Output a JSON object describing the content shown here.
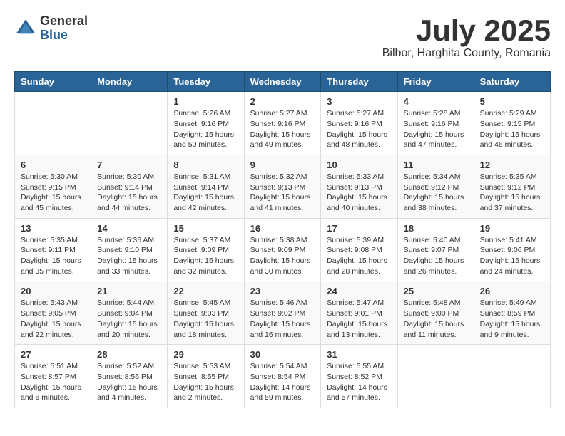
{
  "logo": {
    "general": "General",
    "blue": "Blue"
  },
  "title": "July 2025",
  "subtitle": "Bilbor, Harghita County, Romania",
  "days_of_week": [
    "Sunday",
    "Monday",
    "Tuesday",
    "Wednesday",
    "Thursday",
    "Friday",
    "Saturday"
  ],
  "weeks": [
    [
      {
        "day": "",
        "info": ""
      },
      {
        "day": "",
        "info": ""
      },
      {
        "day": "1",
        "info": "Sunrise: 5:26 AM\nSunset: 9:16 PM\nDaylight: 15 hours and 50 minutes."
      },
      {
        "day": "2",
        "info": "Sunrise: 5:27 AM\nSunset: 9:16 PM\nDaylight: 15 hours and 49 minutes."
      },
      {
        "day": "3",
        "info": "Sunrise: 5:27 AM\nSunset: 9:16 PM\nDaylight: 15 hours and 48 minutes."
      },
      {
        "day": "4",
        "info": "Sunrise: 5:28 AM\nSunset: 9:16 PM\nDaylight: 15 hours and 47 minutes."
      },
      {
        "day": "5",
        "info": "Sunrise: 5:29 AM\nSunset: 9:15 PM\nDaylight: 15 hours and 46 minutes."
      }
    ],
    [
      {
        "day": "6",
        "info": "Sunrise: 5:30 AM\nSunset: 9:15 PM\nDaylight: 15 hours and 45 minutes."
      },
      {
        "day": "7",
        "info": "Sunrise: 5:30 AM\nSunset: 9:14 PM\nDaylight: 15 hours and 44 minutes."
      },
      {
        "day": "8",
        "info": "Sunrise: 5:31 AM\nSunset: 9:14 PM\nDaylight: 15 hours and 42 minutes."
      },
      {
        "day": "9",
        "info": "Sunrise: 5:32 AM\nSunset: 9:13 PM\nDaylight: 15 hours and 41 minutes."
      },
      {
        "day": "10",
        "info": "Sunrise: 5:33 AM\nSunset: 9:13 PM\nDaylight: 15 hours and 40 minutes."
      },
      {
        "day": "11",
        "info": "Sunrise: 5:34 AM\nSunset: 9:12 PM\nDaylight: 15 hours and 38 minutes."
      },
      {
        "day": "12",
        "info": "Sunrise: 5:35 AM\nSunset: 9:12 PM\nDaylight: 15 hours and 37 minutes."
      }
    ],
    [
      {
        "day": "13",
        "info": "Sunrise: 5:35 AM\nSunset: 9:11 PM\nDaylight: 15 hours and 35 minutes."
      },
      {
        "day": "14",
        "info": "Sunrise: 5:36 AM\nSunset: 9:10 PM\nDaylight: 15 hours and 33 minutes."
      },
      {
        "day": "15",
        "info": "Sunrise: 5:37 AM\nSunset: 9:09 PM\nDaylight: 15 hours and 32 minutes."
      },
      {
        "day": "16",
        "info": "Sunrise: 5:38 AM\nSunset: 9:09 PM\nDaylight: 15 hours and 30 minutes."
      },
      {
        "day": "17",
        "info": "Sunrise: 5:39 AM\nSunset: 9:08 PM\nDaylight: 15 hours and 28 minutes."
      },
      {
        "day": "18",
        "info": "Sunrise: 5:40 AM\nSunset: 9:07 PM\nDaylight: 15 hours and 26 minutes."
      },
      {
        "day": "19",
        "info": "Sunrise: 5:41 AM\nSunset: 9:06 PM\nDaylight: 15 hours and 24 minutes."
      }
    ],
    [
      {
        "day": "20",
        "info": "Sunrise: 5:43 AM\nSunset: 9:05 PM\nDaylight: 15 hours and 22 minutes."
      },
      {
        "day": "21",
        "info": "Sunrise: 5:44 AM\nSunset: 9:04 PM\nDaylight: 15 hours and 20 minutes."
      },
      {
        "day": "22",
        "info": "Sunrise: 5:45 AM\nSunset: 9:03 PM\nDaylight: 15 hours and 18 minutes."
      },
      {
        "day": "23",
        "info": "Sunrise: 5:46 AM\nSunset: 9:02 PM\nDaylight: 15 hours and 16 minutes."
      },
      {
        "day": "24",
        "info": "Sunrise: 5:47 AM\nSunset: 9:01 PM\nDaylight: 15 hours and 13 minutes."
      },
      {
        "day": "25",
        "info": "Sunrise: 5:48 AM\nSunset: 9:00 PM\nDaylight: 15 hours and 11 minutes."
      },
      {
        "day": "26",
        "info": "Sunrise: 5:49 AM\nSunset: 8:59 PM\nDaylight: 15 hours and 9 minutes."
      }
    ],
    [
      {
        "day": "27",
        "info": "Sunrise: 5:51 AM\nSunset: 8:57 PM\nDaylight: 15 hours and 6 minutes."
      },
      {
        "day": "28",
        "info": "Sunrise: 5:52 AM\nSunset: 8:56 PM\nDaylight: 15 hours and 4 minutes."
      },
      {
        "day": "29",
        "info": "Sunrise: 5:53 AM\nSunset: 8:55 PM\nDaylight: 15 hours and 2 minutes."
      },
      {
        "day": "30",
        "info": "Sunrise: 5:54 AM\nSunset: 8:54 PM\nDaylight: 14 hours and 59 minutes."
      },
      {
        "day": "31",
        "info": "Sunrise: 5:55 AM\nSunset: 8:52 PM\nDaylight: 14 hours and 57 minutes."
      },
      {
        "day": "",
        "info": ""
      },
      {
        "day": "",
        "info": ""
      }
    ]
  ]
}
